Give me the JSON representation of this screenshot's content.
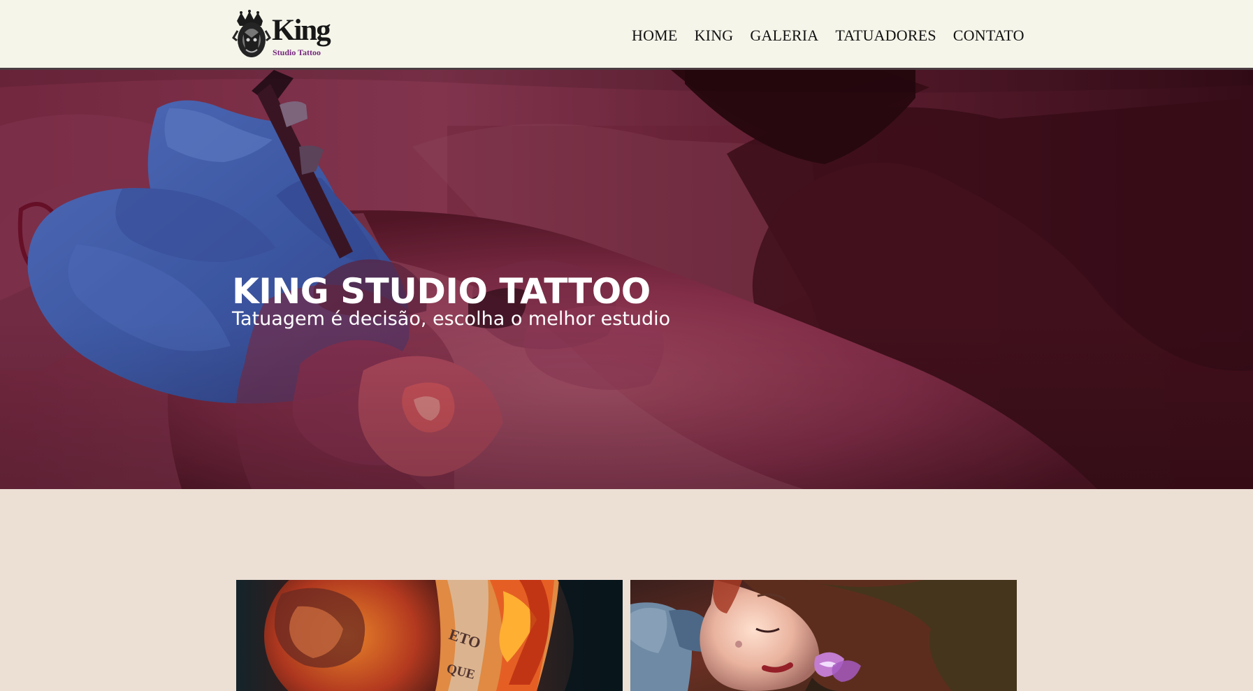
{
  "brand": {
    "name": "King",
    "subtitle": "Studio Tattoo"
  },
  "nav": {
    "home": "HOME",
    "king": "KING",
    "galeria": "GALERIA",
    "tatuadores": "TATUADORES",
    "contato": "CONTATO"
  },
  "hero": {
    "title": "KING STUDIO TATTOO",
    "subtitle": "Tatuagem é decisão, escolha o melhor estudio"
  },
  "colors": {
    "header_background": "#f5f5ea",
    "page_background": "#ecdfd4",
    "hero_overlay": "#5c1727",
    "accent": "#75267d"
  },
  "icons": {
    "logo": "crowned-lion-crest-icon"
  }
}
